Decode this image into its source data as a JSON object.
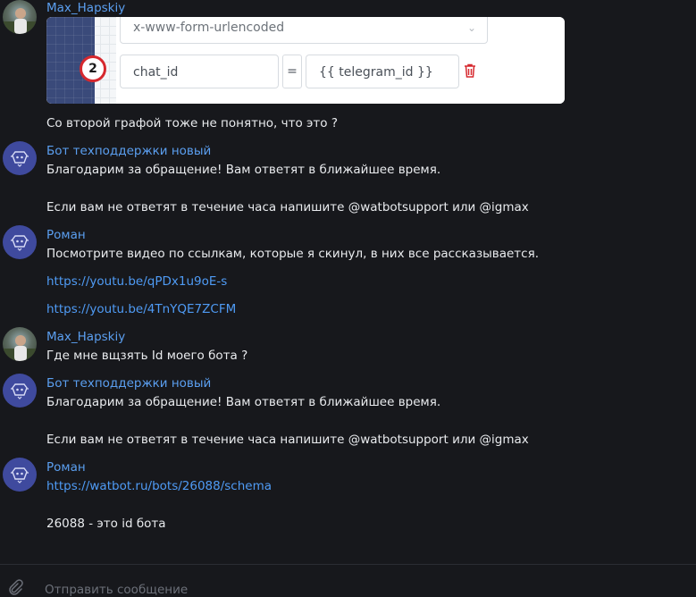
{
  "embedded_screenshot": {
    "select_value": "x-www-form-urlencoded",
    "step_number": "2",
    "key_value": "chat_id",
    "equals": "=",
    "value_value": "{{ telegram_id }}"
  },
  "messages": [
    {
      "sender": "Max_Hapskiy",
      "lines": [
        "Со второй графой тоже не понятно, что это ?"
      ]
    },
    {
      "sender": "Бот техподдержки новый",
      "lines": [
        "Благодарим за обращение! Вам ответят в ближайшее время.",
        "Если вам не ответят в течение часа напишите @watbotsupport или @igmax"
      ]
    },
    {
      "sender": "Роман",
      "lines": [
        "Посмотрите видео по ссылкам, которые я скинул, в них все рассказывается."
      ],
      "links": [
        "https://youtu.be/qPDx1u9oE-s",
        "https://youtu.be/4TnYQE7ZCFM"
      ]
    },
    {
      "sender": "Max_Hapskiy",
      "lines": [
        "Где мне вщзять Id моего бота ?"
      ]
    },
    {
      "sender": "Бот техподдержки новый",
      "lines": [
        "Благодарим за обращение! Вам ответят в ближайшее время.",
        "Если вам не ответят в течение часа напишите @watbotsupport или @igmax"
      ]
    },
    {
      "sender": "Роман",
      "links": [
        "https://watbot.ru/bots/26088/schema"
      ],
      "lines": [
        "26088 - это id бота"
      ]
    }
  ],
  "composer": {
    "placeholder": "Отправить сообщение"
  },
  "colors": {
    "background": "#17181c",
    "sender_name": "#5b9ff0",
    "link": "#4f9bf5",
    "text": "#e9ebee",
    "bot_avatar": "#3f4a9e",
    "badge": "#d6282e"
  }
}
